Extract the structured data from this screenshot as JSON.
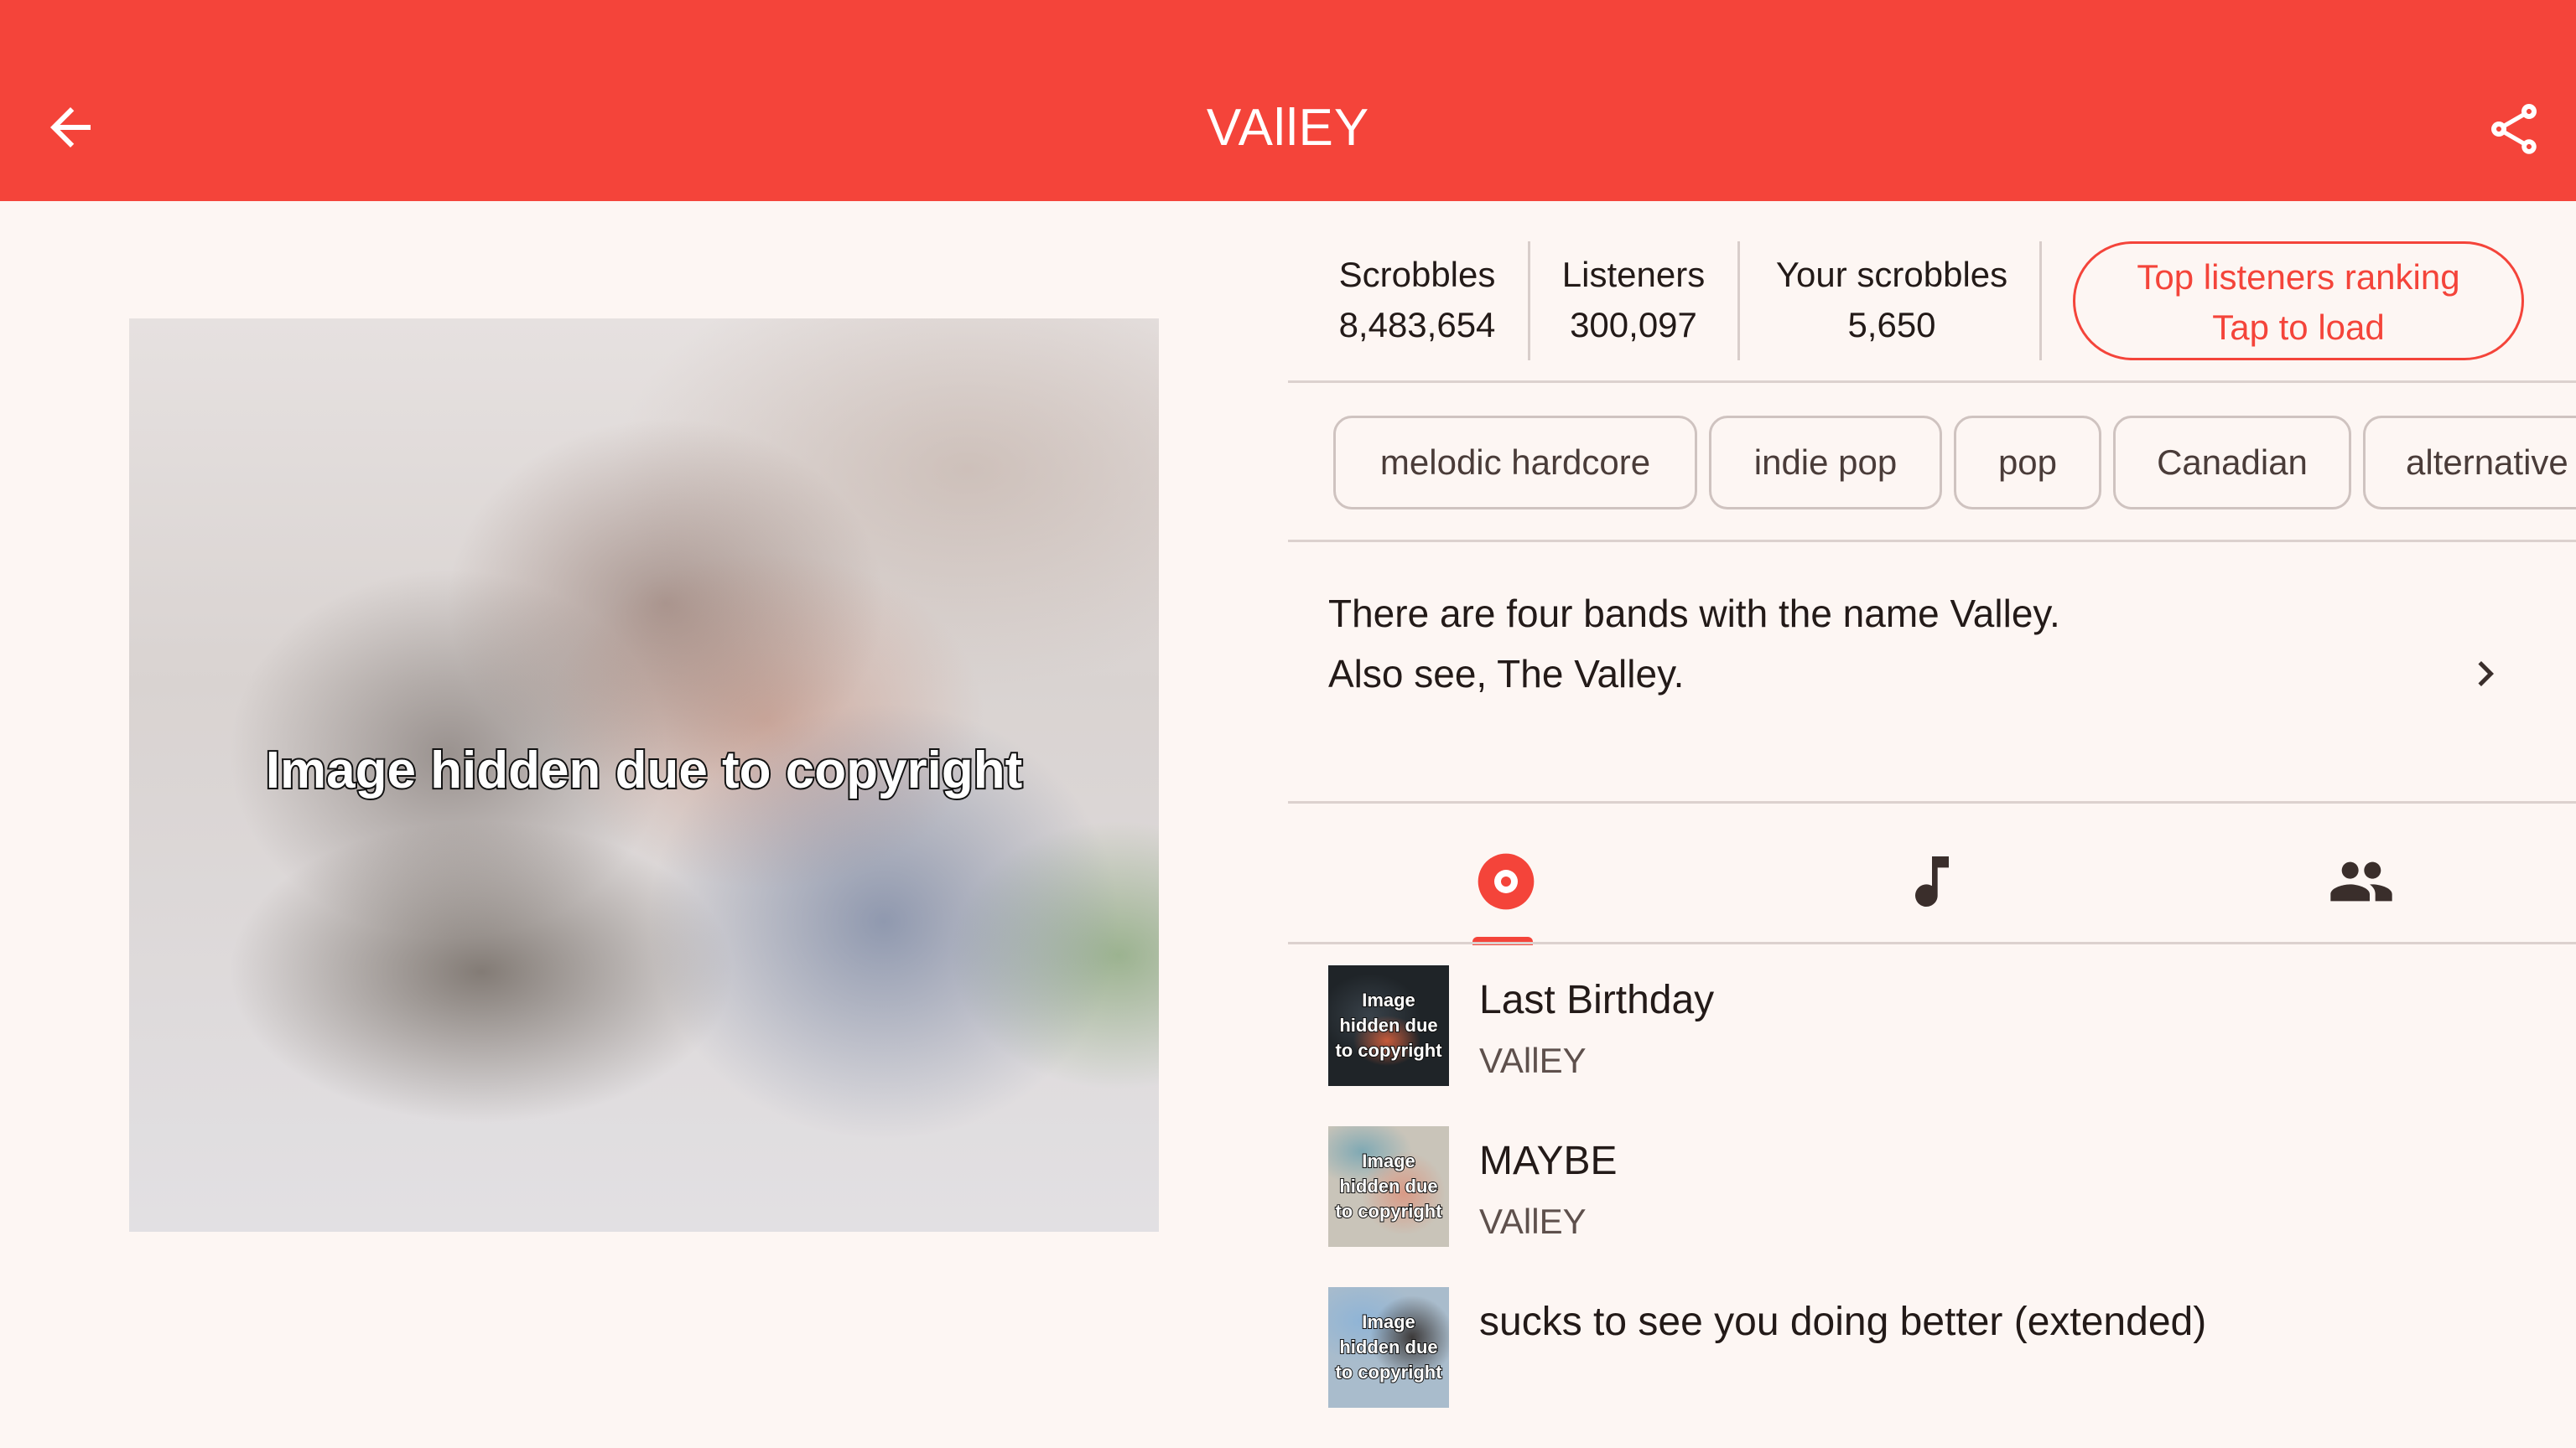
{
  "app_bar": {
    "title": "VAllEY",
    "back_icon": "arrow-back-icon",
    "share_icon": "share-icon",
    "color": "#f4443a"
  },
  "artist_image": {
    "caption": "Image hidden due to copyright"
  },
  "stats": {
    "scrobbles_label": "Scrobbles",
    "scrobbles_value": "8,483,654",
    "listeners_label": "Listeners",
    "listeners_value": "300,097",
    "your_scrobbles_label": "Your scrobbles",
    "your_scrobbles_value": "5,650",
    "top_listeners_line1": "Top listeners ranking",
    "top_listeners_line2": "Tap to load"
  },
  "tags": [
    "melodic hardcore",
    "indie pop",
    "pop",
    "Canadian",
    "alternative p"
  ],
  "bio": {
    "line1": "There are four bands with the name Valley.",
    "line2": "Also see, The Valley.",
    "expand_icon": "chevron-right-icon"
  },
  "tabs": [
    {
      "icon": "album-icon",
      "selected": true
    },
    {
      "icon": "music-note-icon",
      "selected": false
    },
    {
      "icon": "people-icon",
      "selected": false
    }
  ],
  "albums": [
    {
      "title": "Last Birthday",
      "artist": "VAllEY",
      "thumb_caption": "Image hidden due to copyright"
    },
    {
      "title": "MAYBE",
      "artist": "VAllEY",
      "thumb_caption": "Image hidden due to copyright"
    },
    {
      "title": "sucks to see you doing better (extended)",
      "artist": "",
      "thumb_caption": "Image hidden due to copyright"
    }
  ]
}
